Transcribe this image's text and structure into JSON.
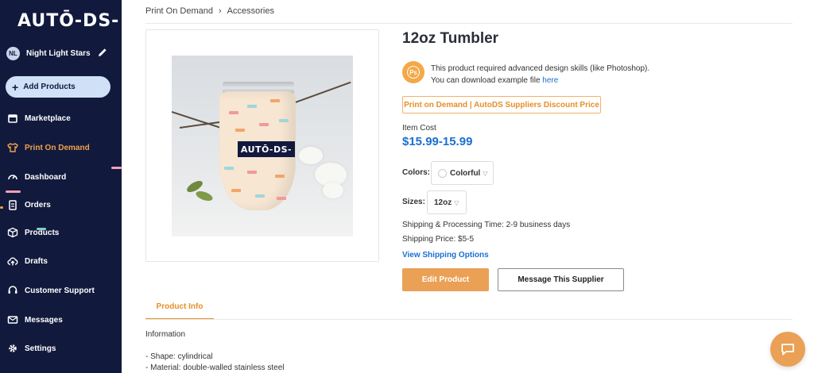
{
  "sidebar": {
    "logo": "AUTŌ-DS-",
    "user": {
      "initials": "NL",
      "name": "Night Light Stars"
    },
    "add_button": "Add Products",
    "items": [
      {
        "label": "Marketplace",
        "icon": "store-icon"
      },
      {
        "label": "Print On Demand",
        "icon": "tshirt-icon",
        "active": true
      },
      {
        "label": "Dashboard",
        "icon": "gauge-icon"
      },
      {
        "label": "Orders",
        "icon": "clipboard-icon"
      },
      {
        "label": "Products",
        "icon": "box-icon"
      },
      {
        "label": "Drafts",
        "icon": "cloud-upload-icon"
      },
      {
        "label": "Customer Support",
        "icon": "headset-icon"
      },
      {
        "label": "Messages",
        "icon": "envelope-icon"
      },
      {
        "label": "Settings",
        "icon": "gear-icon"
      }
    ]
  },
  "breadcrumb": [
    "Print On Demand",
    "Accessories"
  ],
  "product": {
    "title": "12oz Tumbler",
    "image_logo_text": "AUTŌ-DS-",
    "skill_line1": "This product required advanced design skills (like Photoshop).",
    "skill_line2_prefix": "You can download example file",
    "skill_link": "here",
    "ps_icon_label": "Ps",
    "badge": "Print on Demand | AutoDS Suppliers Discount Price",
    "cost_label": "Item Cost",
    "cost_value": "$15.99-15.99",
    "colors_label": "Colors:",
    "color_value": "Colorful",
    "sizes_label": "Sizes:",
    "size_value": "12oz",
    "shipping_time": "Shipping & Processing Time: 2-9 business days",
    "shipping_price": "Shipping Price: $5-5",
    "shipping_link": "View Shipping Options",
    "edit_button": "Edit Product",
    "message_button": "Message This Supplier"
  },
  "tabs": {
    "active": "Product Info"
  },
  "info": {
    "title": "Information",
    "lines": [
      "- Shape: cylindrical",
      "- Material: double-walled stainless steel"
    ]
  },
  "colors": {
    "sidebar_bg": "#111a3d",
    "accent": "#eaa055",
    "link": "#1a6fd1"
  }
}
